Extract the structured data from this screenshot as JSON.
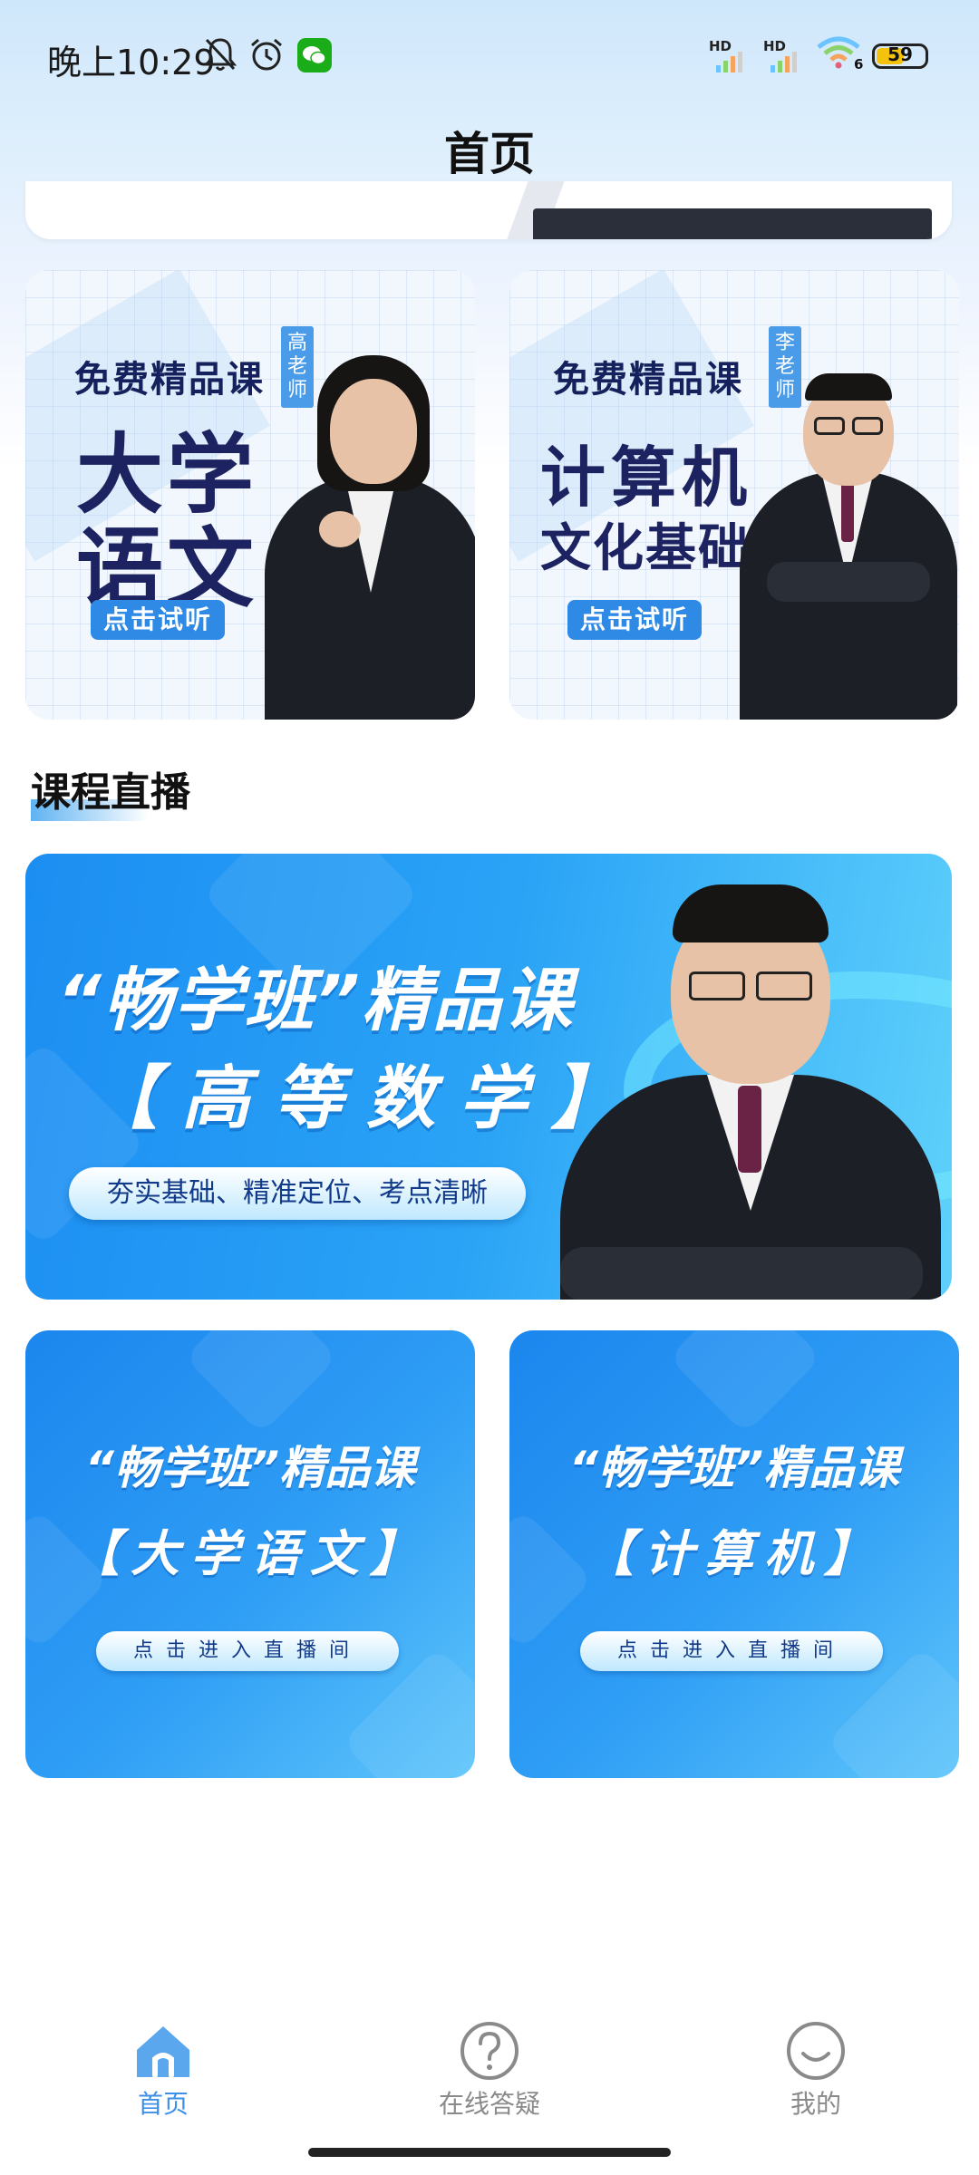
{
  "status_bar": {
    "time": "晚上10:29",
    "network_label_1": "HD",
    "network_label_2": "HD",
    "wifi_label": "6",
    "battery": "59"
  },
  "header": {
    "title": "首页"
  },
  "free_courses": [
    {
      "tag": "免费精品课",
      "subject_line1": "大学",
      "subject_line2": "语文",
      "teacher": "高老师",
      "button": "点击试听"
    },
    {
      "tag": "免费精品课",
      "subject_line1": "计算机",
      "subject_line2": "文化基础",
      "teacher": "李老师",
      "button": "点击试听"
    }
  ],
  "live_section": {
    "title": "课程直播",
    "banner": {
      "headline": "“畅学班”精品课",
      "subject": "【高等数学】",
      "slogan": "夯实基础、精准定位、考点清晰"
    },
    "rooms": [
      {
        "headline": "“畅学班”精品课",
        "subject": "【大学语文】",
        "button": "点击进入直播间"
      },
      {
        "headline": "“畅学班”精品课",
        "subject": "【计算机】",
        "button": "点击进入直播间"
      }
    ]
  },
  "bottom_nav": {
    "items": [
      {
        "label": "首页",
        "icon": "home-icon",
        "active": true
      },
      {
        "label": "在线答疑",
        "icon": "question-icon",
        "active": false
      },
      {
        "label": "我的",
        "icon": "smile-icon",
        "active": false
      }
    ]
  },
  "colors": {
    "accent": "#3d8fe8",
    "banner_blue": "#1c8ef2",
    "tag_blue": "#4a9be8"
  }
}
